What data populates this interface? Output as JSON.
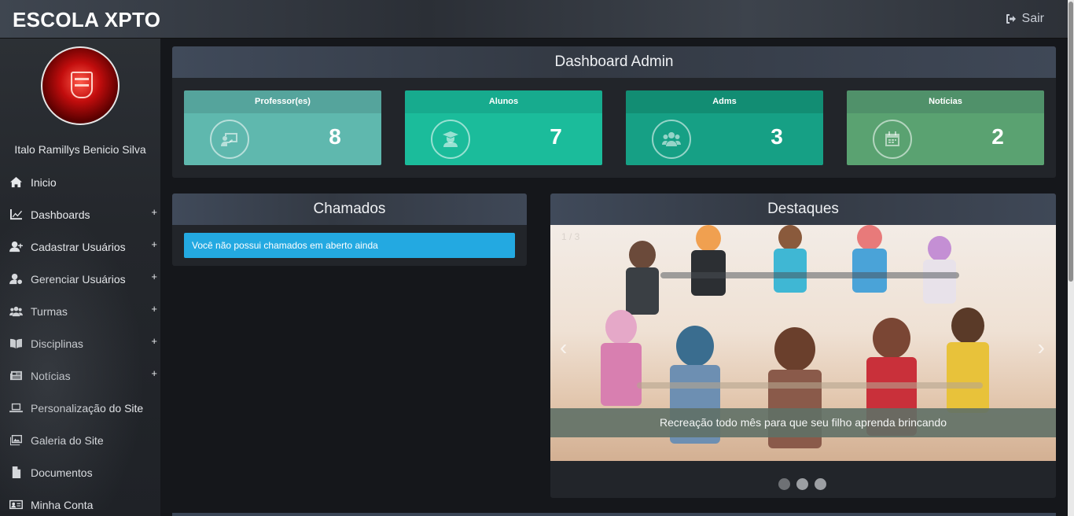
{
  "header": {
    "brand": "ESCOLA XPTO",
    "logout_label": "Sair"
  },
  "user": {
    "name": "Italo Ramillys Benicio Silva"
  },
  "sidebar": {
    "items": [
      {
        "label": "Inicio",
        "icon": "home-icon",
        "expandable": false
      },
      {
        "label": "Dashboards",
        "icon": "chart-line-icon",
        "expandable": true
      },
      {
        "label": "Cadastrar Usuários",
        "icon": "user-plus-icon",
        "expandable": true
      },
      {
        "label": "Gerenciar Usuários",
        "icon": "user-cog-icon",
        "expandable": true
      },
      {
        "label": "Turmas",
        "icon": "users-icon",
        "expandable": true
      },
      {
        "label": "Disciplinas",
        "icon": "book-open-icon",
        "expandable": true
      },
      {
        "label": "Notícias",
        "icon": "newspaper-icon",
        "expandable": true
      },
      {
        "label": "Personalização do Site",
        "icon": "laptop-icon",
        "expandable": false
      },
      {
        "label": "Galeria do Site",
        "icon": "images-icon",
        "expandable": false
      },
      {
        "label": "Documentos",
        "icon": "file-icon",
        "expandable": false
      },
      {
        "label": "Minha Conta",
        "icon": "id-card-icon",
        "expandable": false
      }
    ],
    "expand_glyph": "+"
  },
  "dashboard": {
    "title": "Dashboard Admin",
    "cards": [
      {
        "title": "Professor(es)",
        "count": "8",
        "icon": "chalkboard-teacher-icon",
        "color": "#5fb8ae"
      },
      {
        "title": "Alunos",
        "count": "7",
        "icon": "user-graduate-icon",
        "color": "#1bbc9b"
      },
      {
        "title": "Adms",
        "count": "3",
        "icon": "users-icon",
        "color": "#16a085"
      },
      {
        "title": "Notícias",
        "count": "2",
        "icon": "calendar-icon",
        "color": "#5aa271"
      }
    ]
  },
  "chamados": {
    "title": "Chamados",
    "alert": "Você não possui chamados em aberto ainda",
    "alert_color": "#23a9e1"
  },
  "destaques": {
    "title": "Destaques",
    "counter": "1 / 3",
    "caption": "Recreação todo mês para que seu filho aprenda brincando",
    "prev": "‹",
    "next": "›",
    "slide_count": 3,
    "active_slide": 1
  }
}
